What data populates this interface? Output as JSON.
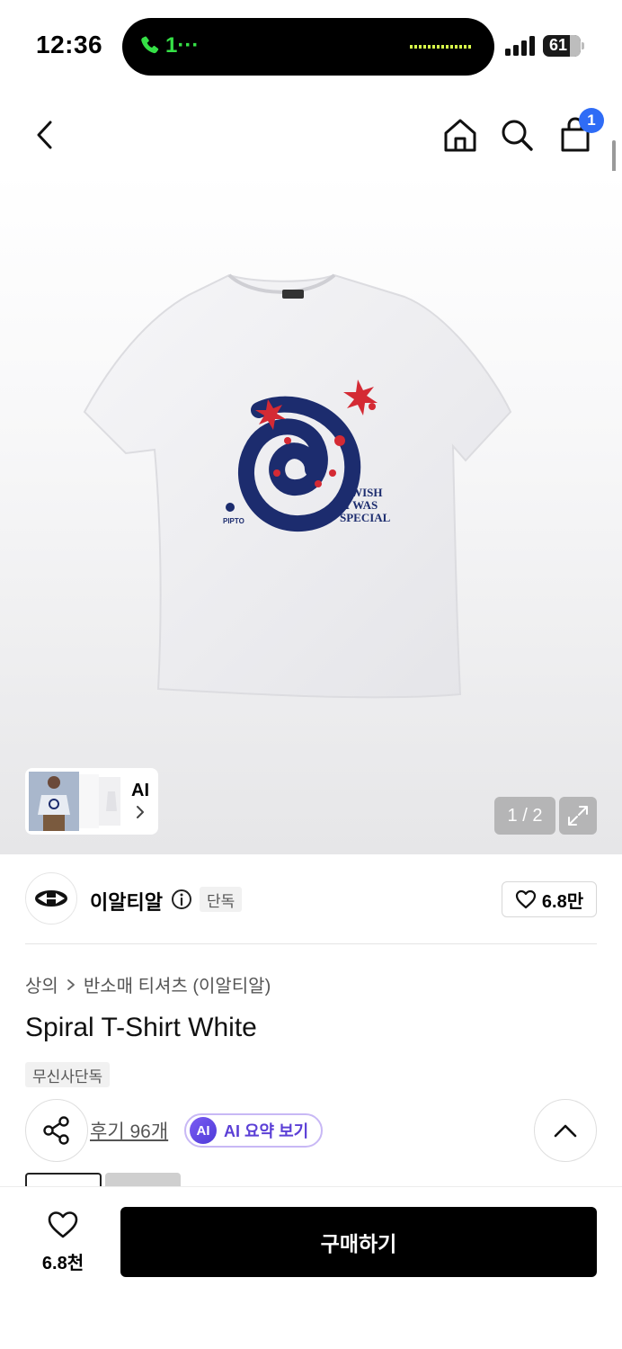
{
  "status_bar": {
    "time": "12:36",
    "call_text": "1",
    "battery": "61",
    "call_color": "#35e046"
  },
  "nav": {
    "back_icon": "chevron-left-icon",
    "home_icon": "home-icon",
    "search_icon": "search-icon",
    "cart_icon": "shopping-bag-icon",
    "cart_badge": "1",
    "badge_color": "#2f6cf6"
  },
  "gallery": {
    "thumb_label": "AI",
    "counter": "1 / 2",
    "expand_icon": "expand-icon"
  },
  "brand": {
    "name": "이알티알",
    "tag": "단독",
    "like_count": "6.8만"
  },
  "product": {
    "breadcrumb": [
      "상의",
      "반소매 티셔츠 (이알티알)"
    ],
    "title": "Spiral T-Shirt White",
    "tag": "무신사단독",
    "review_link": "후기 96개",
    "ai_badge": "AI",
    "ai_summary": "AI 요약 보기"
  },
  "bottom": {
    "wish_count": "6.8천",
    "buy_label": "구매하기"
  }
}
